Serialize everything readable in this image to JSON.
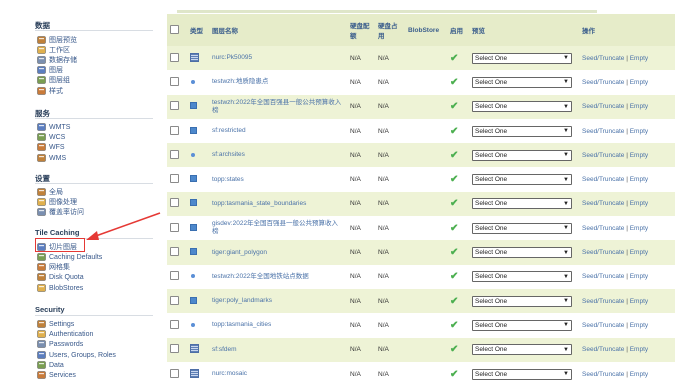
{
  "sidebar": {
    "sections": [
      {
        "title": "数据",
        "items": [
          {
            "label": "图层预览",
            "icon": "layer-preview-icon"
          },
          {
            "label": "工作区",
            "icon": "folder-icon"
          },
          {
            "label": "数据存储",
            "icon": "datastore-icon"
          },
          {
            "label": "图层",
            "icon": "layers-icon"
          },
          {
            "label": "图层组",
            "icon": "layer-group-icon"
          },
          {
            "label": "样式",
            "icon": "style-icon"
          }
        ]
      },
      {
        "title": "服务",
        "items": [
          {
            "label": "WMTS",
            "icon": "wmts-icon"
          },
          {
            "label": "WCS",
            "icon": "wcs-icon"
          },
          {
            "label": "WFS",
            "icon": "wfs-icon"
          },
          {
            "label": "WMS",
            "icon": "wms-icon"
          }
        ]
      },
      {
        "title": "设置",
        "items": [
          {
            "label": "全局",
            "icon": "global-icon"
          },
          {
            "label": "图像处理",
            "icon": "image-processing-icon"
          },
          {
            "label": "覆盖率访问",
            "icon": "coverage-access-icon"
          }
        ]
      },
      {
        "title": "Tile Caching",
        "items": [
          {
            "label": "切片图层",
            "icon": "tile-layers-icon"
          },
          {
            "label": "Caching Defaults",
            "icon": "caching-defaults-icon"
          },
          {
            "label": "网格集",
            "icon": "gridsets-icon"
          },
          {
            "label": "Disk Quota",
            "icon": "disk-quota-icon"
          },
          {
            "label": "BlobStores",
            "icon": "blobstores-icon"
          }
        ]
      },
      {
        "title": "Security",
        "items": [
          {
            "label": "Settings",
            "icon": "settings-icon"
          },
          {
            "label": "Authentication",
            "icon": "authentication-icon"
          },
          {
            "label": "Passwords",
            "icon": "passwords-icon"
          },
          {
            "label": "Users, Groups, Roles",
            "icon": "users-icon"
          },
          {
            "label": "Data",
            "icon": "data-security-icon"
          },
          {
            "label": "Services",
            "icon": "services-security-icon"
          }
        ]
      }
    ]
  },
  "table": {
    "headers": {
      "type": "类型",
      "name": "图层名称",
      "disk_quota": "硬盘配额",
      "disk_used": "硬盘占用",
      "blobstore": "BlobStore",
      "enabled": "启用",
      "preview": "预览",
      "actions": "操作"
    },
    "rows": [
      {
        "type": "grid",
        "name": "nurc:Pk50095",
        "quota": "N/A",
        "used": "N/A",
        "preview": "Select One",
        "seed": "Seed/Truncate",
        "empty": "Empty"
      },
      {
        "type": "point",
        "name": "testwzh:地质隐患点",
        "quota": "N/A",
        "used": "N/A",
        "preview": "Select One",
        "seed": "Seed/Truncate",
        "empty": "Empty"
      },
      {
        "type": "polygon",
        "name": "testwzh:2022年全国百强县一般公共预算收入榜",
        "quota": "N/A",
        "used": "N/A",
        "preview": "Select One",
        "seed": "Seed/Truncate",
        "empty": "Empty"
      },
      {
        "type": "polygon",
        "name": "sf:restricted",
        "quota": "N/A",
        "used": "N/A",
        "preview": "Select One",
        "seed": "Seed/Truncate",
        "empty": "Empty"
      },
      {
        "type": "point",
        "name": "sf:archsites",
        "quota": "N/A",
        "used": "N/A",
        "preview": "Select One",
        "seed": "Seed/Truncate",
        "empty": "Empty"
      },
      {
        "type": "polygon",
        "name": "topp:states",
        "quota": "N/A",
        "used": "N/A",
        "preview": "Select One",
        "seed": "Seed/Truncate",
        "empty": "Empty"
      },
      {
        "type": "polygon",
        "name": "topp:tasmania_state_boundaries",
        "quota": "N/A",
        "used": "N/A",
        "preview": "Select One",
        "seed": "Seed/Truncate",
        "empty": "Empty"
      },
      {
        "type": "polygon",
        "name": "gisdev:2022年全国百强县一般公共预算收入榜",
        "quota": "N/A",
        "used": "N/A",
        "preview": "Select One",
        "seed": "Seed/Truncate",
        "empty": "Empty"
      },
      {
        "type": "polygon",
        "name": "tiger:giant_polygon",
        "quota": "N/A",
        "used": "N/A",
        "preview": "Select One",
        "seed": "Seed/Truncate",
        "empty": "Empty"
      },
      {
        "type": "point",
        "name": "testwzh:2022年全国地铁站点数据",
        "quota": "N/A",
        "used": "N/A",
        "preview": "Select One",
        "seed": "Seed/Truncate",
        "empty": "Empty"
      },
      {
        "type": "polygon",
        "name": "tiger:poly_landmarks",
        "quota": "N/A",
        "used": "N/A",
        "preview": "Select One",
        "seed": "Seed/Truncate",
        "empty": "Empty"
      },
      {
        "type": "point",
        "name": "topp:tasmania_cities",
        "quota": "N/A",
        "used": "N/A",
        "preview": "Select One",
        "seed": "Seed/Truncate",
        "empty": "Empty"
      },
      {
        "type": "grid",
        "name": "sf:sfdem",
        "quota": "N/A",
        "used": "N/A",
        "preview": "Select One",
        "seed": "Seed/Truncate",
        "empty": "Empty"
      },
      {
        "type": "grid",
        "name": "nurc:mosaic",
        "quota": "N/A",
        "used": "N/A",
        "preview": "Select One",
        "seed": "Seed/Truncate",
        "empty": "Empty"
      }
    ]
  },
  "colors": {
    "accent": "#4a72a8",
    "row_alt": "#eef3d6",
    "header_bg": "#e6ecc9",
    "highlight": "#e53935",
    "check": "#4caf50"
  }
}
